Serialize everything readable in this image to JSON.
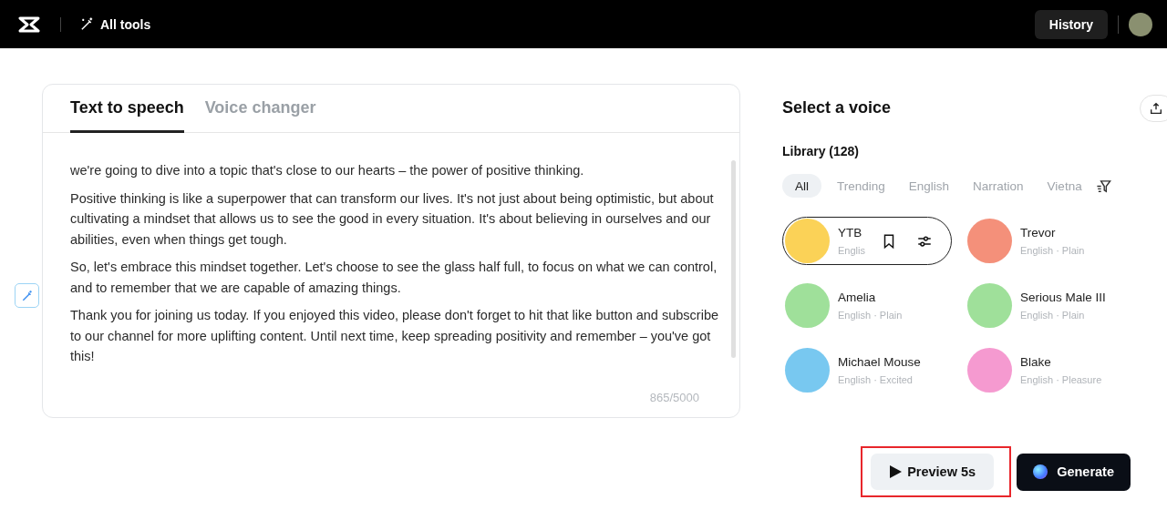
{
  "header": {
    "tools_label": "All tools",
    "history_button": "History"
  },
  "editor": {
    "tabs": [
      {
        "label": "Text to speech",
        "selected": true
      },
      {
        "label": "Voice changer",
        "selected": false
      }
    ],
    "paragraphs": [
      "we're going to dive into a topic that's close to our hearts – the power of positive thinking.",
      "Positive thinking is like a superpower that can transform our lives. It's not just about being optimistic, but about cultivating a mindset that allows us to see the good in every situation. It's about believing in ourselves and our abilities, even when things get tough.",
      "So, let's embrace this mindset together. Let's choose to see the glass half full, to focus on what we can control, and to remember that we are capable of amazing things.",
      "Thank you for joining us today. If you enjoyed this video, please don't forget to hit that like button and subscribe to our channel for more uplifting content. Until next time, keep spreading positivity and remember – you've got this!"
    ],
    "char_count": "865/5000"
  },
  "voice_panel": {
    "title": "Select a voice",
    "library_label": "Library (128)",
    "filters": [
      {
        "label": "All",
        "selected": true
      },
      {
        "label": "Trending",
        "selected": false
      },
      {
        "label": "English",
        "selected": false
      },
      {
        "label": "Narration",
        "selected": false
      },
      {
        "label": "Vietna",
        "selected": false
      }
    ],
    "voices": [
      {
        "name": "YTB",
        "meta": "Englis",
        "color": "#fbd257",
        "selected": true
      },
      {
        "name": "Trevor",
        "meta": "English · Plain",
        "color": "#f4907a",
        "selected": false
      },
      {
        "name": "Amelia",
        "meta": "English · Plain",
        "color": "#9fe09a",
        "selected": false
      },
      {
        "name": "Serious Male III",
        "meta": "English · Plain",
        "color": "#9fe09a",
        "selected": false
      },
      {
        "name": "Michael Mouse",
        "meta": "English · Excited",
        "color": "#78c8f0",
        "selected": false
      },
      {
        "name": "Blake",
        "meta": "English · Pleasure",
        "color": "#f59ad0",
        "selected": false
      }
    ]
  },
  "actions": {
    "preview_button": "Preview 5s",
    "preview_highlighted": true,
    "generate_button": "Generate"
  }
}
